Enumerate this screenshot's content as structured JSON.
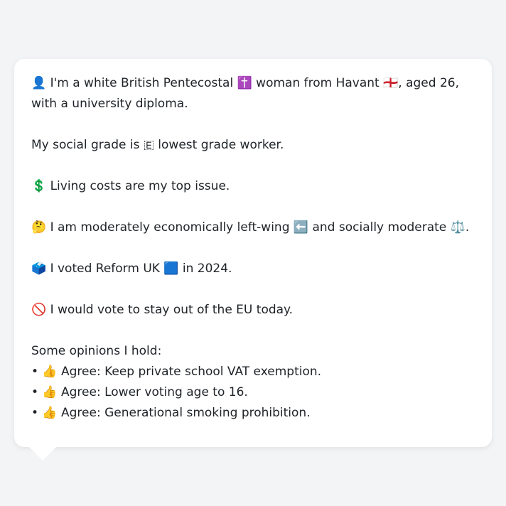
{
  "profile": {
    "intro": "👤 I'm a white British Pentecostal ✝️ woman from Havant 🏴󠁧󠁢󠁥󠁮󠁧󠁿, aged 26, with a university diploma.",
    "social_grade": "My social grade is 🇪 lowest grade worker.",
    "top_issue": "💲 Living costs are my top issue.",
    "ideology": "🤔 I am moderately economically left-wing ⬅️ and socially moderate ⚖️.",
    "vote_2024": "🗳️ I voted Reform UK 🟦 in 2024.",
    "eu_vote": "🚫 I would vote to stay out of the EU today.",
    "opinions_heading": "Some opinions I hold:",
    "opinions": [
      "• 👍 Agree: Keep private school VAT exemption.",
      "• 👍 Agree: Lower voting age to 16.",
      "• 👍 Agree: Generational smoking prohibition."
    ]
  }
}
